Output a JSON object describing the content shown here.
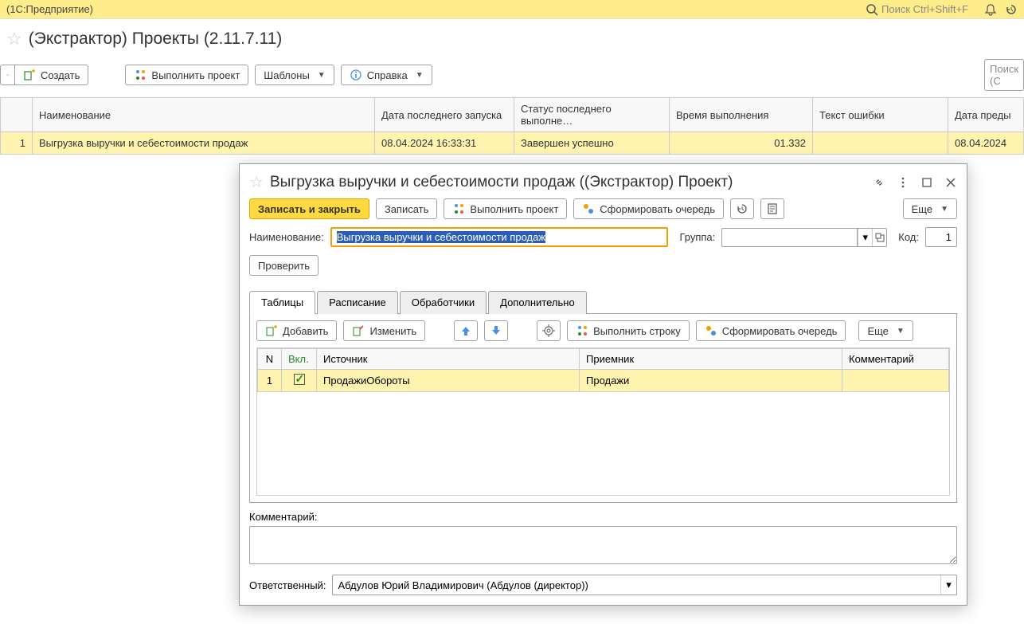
{
  "top": {
    "app_name": "(1С:Предприятие)",
    "search_placeholder": "Поиск Ctrl+Shift+F"
  },
  "page": {
    "title": "(Экстрактор) Проекты (2.11.7.11)",
    "toolbar": {
      "create": "Создать",
      "run_project": "Выполнить проект",
      "templates": "Шаблоны",
      "help": "Справка",
      "search_placeholder": "Поиск (С"
    }
  },
  "main_table": {
    "headers": {
      "name": "Наименование",
      "last_run": "Дата последнего запуска",
      "status": "Статус последнего выполне…",
      "exec_time": "Время выполнения",
      "error_text": "Текст ошибки",
      "prev_date": "Дата преды"
    },
    "rows": [
      {
        "num": "1",
        "name": "Выгрузка выручки и себестоимости продаж",
        "last_run": "08.04.2024 16:33:31",
        "status": "Завершен успешно",
        "exec_time": "01.332",
        "error_text": "",
        "prev_date": "08.04.2024"
      }
    ]
  },
  "dialog": {
    "title": "Выгрузка выручки и себестоимости продаж ((Экстрактор) Проект)",
    "toolbar": {
      "save_close": "Записать и закрыть",
      "save": "Записать",
      "run_project": "Выполнить проект",
      "form_queue": "Сформировать очередь",
      "more": "Еще"
    },
    "form": {
      "name_label": "Наименование:",
      "name_value": "Выгрузка выручки и себестоимости продаж",
      "group_label": "Группа:",
      "code_label": "Код:",
      "code_value": "1",
      "check_btn": "Проверить"
    },
    "tabs": {
      "tables": "Таблицы",
      "schedule": "Расписание",
      "handlers": "Обработчики",
      "additional": "Дополнительно"
    },
    "tab_toolbar": {
      "add": "Добавить",
      "edit": "Изменить",
      "run_row": "Выполнить строку",
      "form_queue": "Сформировать очередь",
      "more": "Еще"
    },
    "inner_table": {
      "headers": {
        "n": "N",
        "enabled": "Вкл.",
        "source": "Источник",
        "target": "Приемник",
        "comment": "Комментарий"
      },
      "rows": [
        {
          "n": "1",
          "enabled": true,
          "source": "ПродажиОбороты",
          "target": "Продажи",
          "comment": ""
        }
      ]
    },
    "comment_label": "Комментарий:",
    "responsible_label": "Ответственный:",
    "responsible_value": "Абдулов Юрий Владимирович (Абдулов (директор))"
  }
}
